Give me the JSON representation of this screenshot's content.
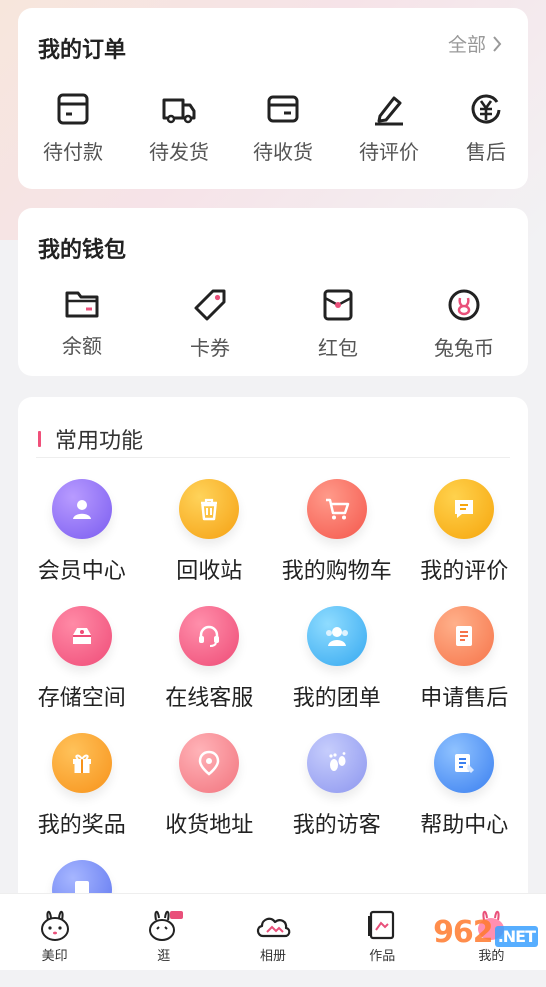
{
  "colors": {
    "accent": "#f0507a",
    "page_bg": "#f2f2f4"
  },
  "orders": {
    "title": "我的订单",
    "all_label": "全部",
    "items": [
      {
        "label": "待付款",
        "icon": "payment-icon"
      },
      {
        "label": "待发货",
        "icon": "truck-icon"
      },
      {
        "label": "待收货",
        "icon": "receive-box-icon"
      },
      {
        "label": "待评价",
        "icon": "pen-icon"
      },
      {
        "label": "售后",
        "icon": "yuan-refund-icon"
      }
    ]
  },
  "wallet": {
    "title": "我的钱包",
    "items": [
      {
        "label": "余额",
        "icon": "folder-icon"
      },
      {
        "label": "卡券",
        "icon": "tag-icon"
      },
      {
        "label": "红包",
        "icon": "red-envelope-icon"
      },
      {
        "label": "兔兔币",
        "icon": "rabbit-coin-icon"
      }
    ]
  },
  "functions": {
    "title": "常用功能",
    "items": [
      {
        "label": "会员中心",
        "icon": "member-icon"
      },
      {
        "label": "回收站",
        "icon": "trash-icon"
      },
      {
        "label": "我的购物车",
        "icon": "cart-icon"
      },
      {
        "label": "我的评价",
        "icon": "comment-icon"
      },
      {
        "label": "存储空间",
        "icon": "storage-icon"
      },
      {
        "label": "在线客服",
        "icon": "headset-icon"
      },
      {
        "label": "我的团单",
        "icon": "group-icon"
      },
      {
        "label": "申请售后",
        "icon": "document-icon"
      },
      {
        "label": "我的奖品",
        "icon": "gift-icon"
      },
      {
        "label": "收货地址",
        "icon": "location-icon"
      },
      {
        "label": "我的访客",
        "icon": "footprint-icon"
      },
      {
        "label": "帮助中心",
        "icon": "help-icon"
      }
    ]
  },
  "tabbar": {
    "items": [
      {
        "label": "美印",
        "icon": "rabbit-icon"
      },
      {
        "label": "逛",
        "icon": "rabbit-shop-icon"
      },
      {
        "label": "相册",
        "icon": "cloud-album-icon"
      },
      {
        "label": "作品",
        "icon": "works-icon"
      },
      {
        "label": "我的",
        "icon": "profile-icon"
      }
    ]
  },
  "watermark": {
    "text": "962",
    "suffix": ".NET"
  }
}
